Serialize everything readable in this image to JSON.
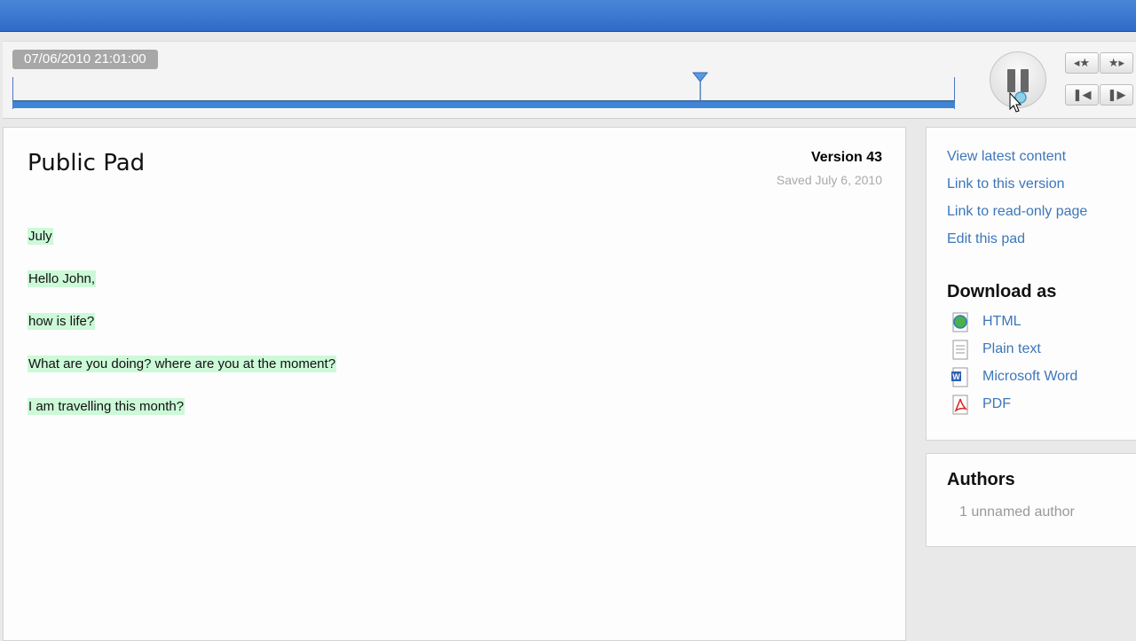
{
  "timeslider": {
    "timestamp": "07/06/2010 21:01:00",
    "position": 0.73,
    "controls": {
      "pause_icon": "pause-icon",
      "prev_star_icon": "prev-saved-revision-icon",
      "next_star_icon": "next-saved-revision-icon",
      "step_back_icon": "step-back-icon",
      "step_forward_icon": "step-forward-icon"
    }
  },
  "pad": {
    "title": "Public Pad",
    "version": "Version 43",
    "saved": "Saved July 6, 2010",
    "lines": [
      "July",
      "Hello John,",
      "how is life?",
      "What are you doing? where are you at the moment?",
      "I am travelling this month?"
    ],
    "highlight_color": "#ccf9d7"
  },
  "sidebar": {
    "links": [
      "View latest content",
      "Link to this version",
      "Link to read-only page",
      "Edit this pad"
    ],
    "download_heading": "Download as",
    "downloads": [
      {
        "label": "HTML",
        "icon": "html-file-icon"
      },
      {
        "label": "Plain text",
        "icon": "text-file-icon"
      },
      {
        "label": "Microsoft Word",
        "icon": "word-file-icon"
      },
      {
        "label": "PDF",
        "icon": "pdf-file-icon"
      }
    ],
    "authors_heading": "Authors",
    "authors_text": "1 unnamed author"
  },
  "colors": {
    "header_blue": "#3a78d0",
    "link_blue": "#3d76b8",
    "slider_fill": "#3e85d8"
  }
}
